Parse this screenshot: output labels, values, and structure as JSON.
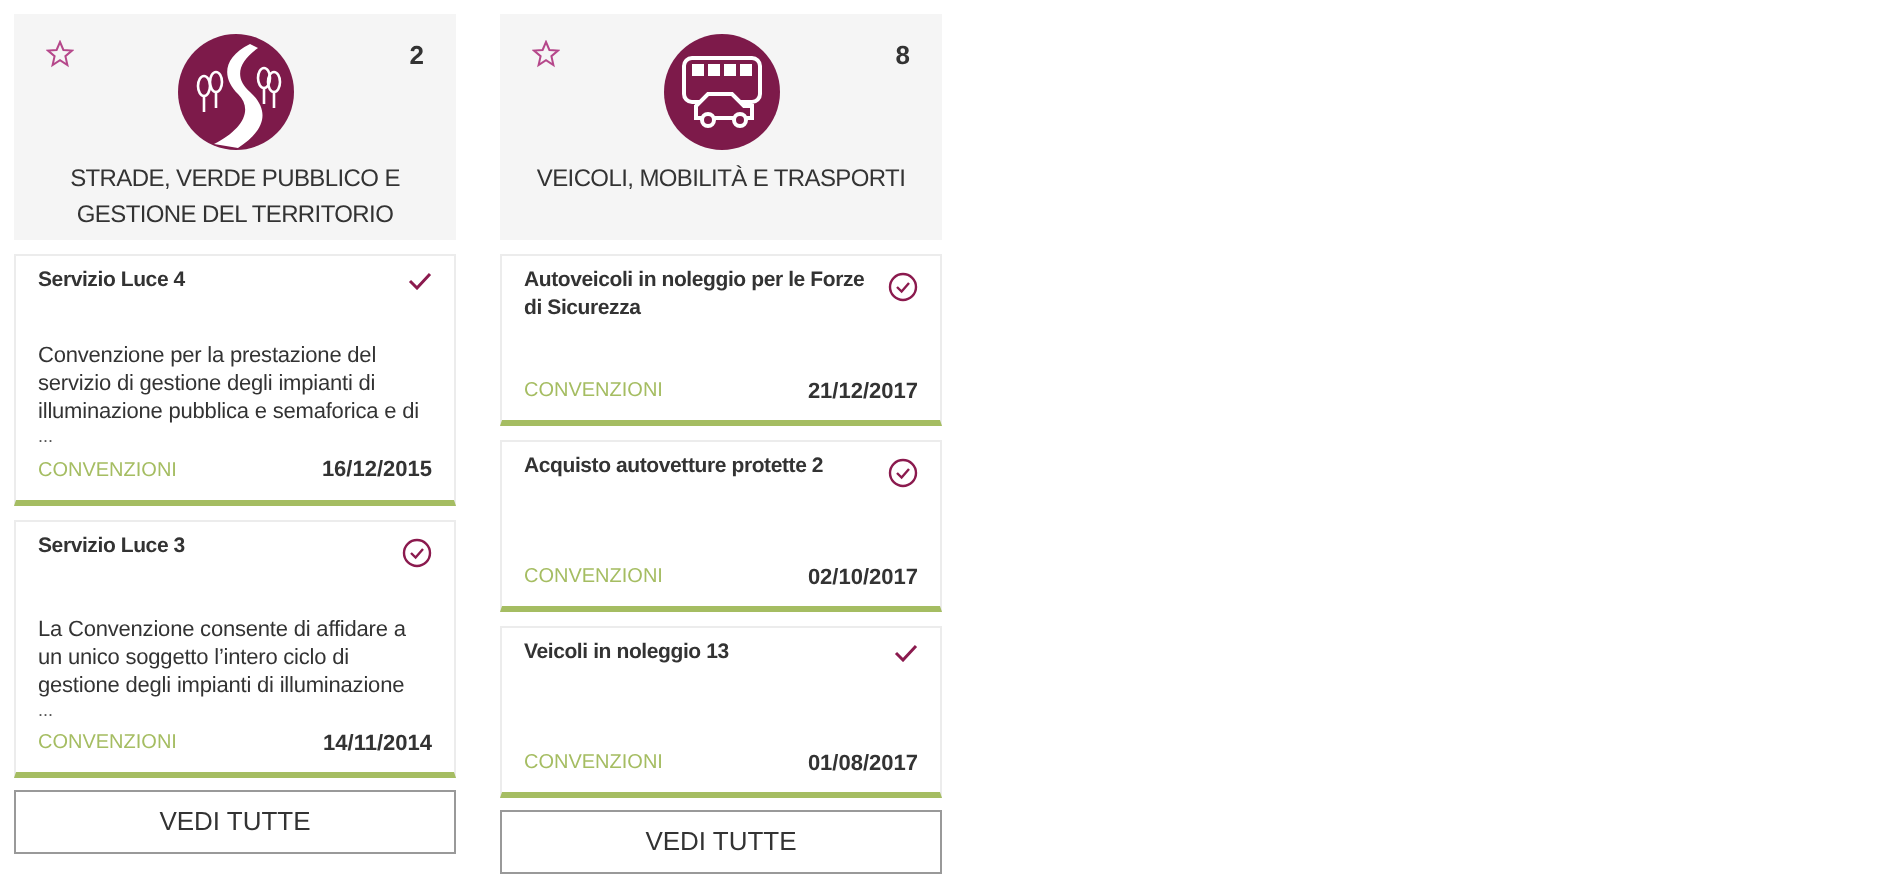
{
  "categories": [
    {
      "title": "STRADE, VERDE PUBBLICO E GESTIONE DEL TERRITORIO",
      "count": "2",
      "favorite": false,
      "items": [
        {
          "title": "Servizio Luce 4",
          "kind": "check",
          "description": "Convenzione per la prestazione del servizio di gestione degli impianti di illuminazione pubblica e semaforica e di",
          "more": "...",
          "type": "CONVENZIONI",
          "date": "16/12/2015"
        },
        {
          "title": "Servizio Luce 3",
          "kind": "check_circle",
          "description": "La Convenzione consente di affidare a un unico soggetto l’intero ciclo di gestione degli impianti di illuminazione",
          "more": "...",
          "type": "CONVENZIONI",
          "date": "14/11/2014"
        }
      ],
      "button": "VEDI TUTTE"
    },
    {
      "title": "VEICOLI, MOBILITÀ E TRASPORTI",
      "count": "8",
      "favorite": false,
      "items": [
        {
          "title": "Autoveicoli in noleggio per le Forze di Sicurezza",
          "kind": "check_circle",
          "type": "CONVENZIONI",
          "date": "21/12/2017"
        },
        {
          "title": "Acquisto autovetture protette 2",
          "kind": "check_circle",
          "type": "CONVENZIONI",
          "date": "02/10/2017"
        },
        {
          "title": "Veicoli in noleggio 13",
          "kind": "check",
          "type": "CONVENZIONI",
          "date": "01/08/2017"
        }
      ],
      "button": "VEDI TUTTE"
    }
  ]
}
